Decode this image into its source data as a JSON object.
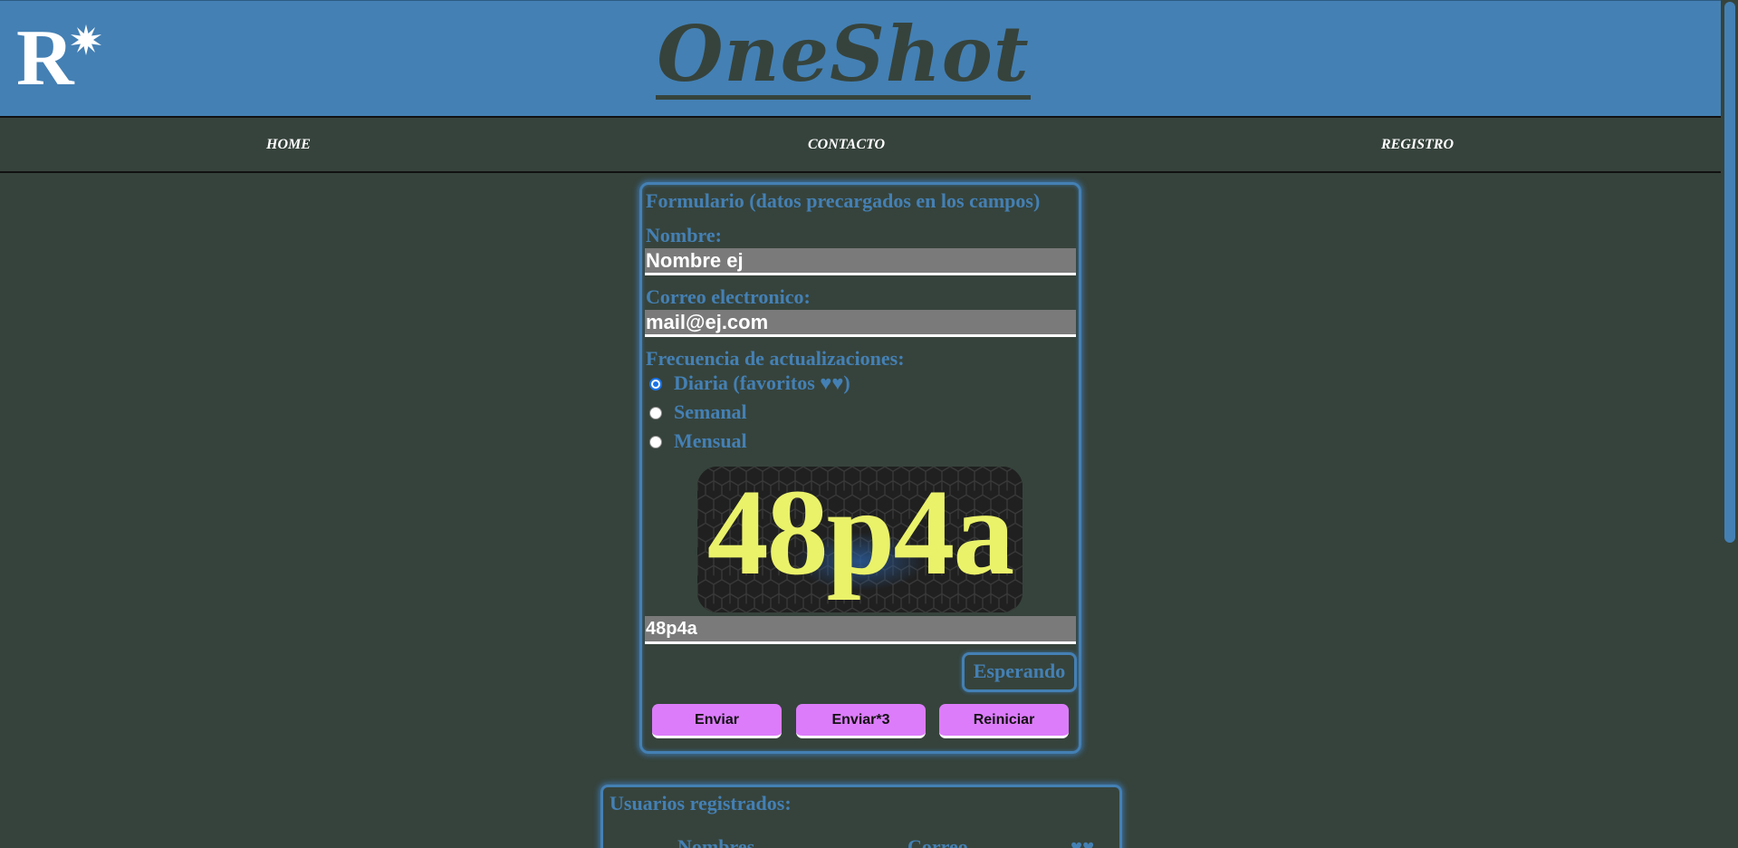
{
  "header": {
    "logo_letter": "R",
    "title": "OneShot",
    "brand_color": "#4480b4"
  },
  "nav": {
    "items": [
      {
        "label": "HOME"
      },
      {
        "label": "CONTACTO"
      },
      {
        "label": "REGISTRO"
      }
    ]
  },
  "form": {
    "title": "Formulario (datos precargados en los campos)",
    "name_label": "Nombre:",
    "name_value": "Nombre ej",
    "email_label": "Correo electronico:",
    "email_value": "mail@ej.com",
    "frequency_label": "Frecuencia de actualizaciones:",
    "options": [
      {
        "label": "Diaria (favoritos ♥♥)",
        "checked": true
      },
      {
        "label": "Semanal",
        "checked": false
      },
      {
        "label": "Mensual",
        "checked": false
      }
    ],
    "captcha_code": "48p4a",
    "captcha_value": "48p4a",
    "status": "Esperando",
    "buttons": {
      "send": "Enviar",
      "send3": "Enviar*3",
      "reset": "Reiniciar"
    },
    "button_color": "#dc7cfa"
  },
  "users": {
    "title": "Usuarios registrados:",
    "columns": {
      "names": "Nombres",
      "email": "Correo",
      "fav": "♥♥"
    }
  }
}
